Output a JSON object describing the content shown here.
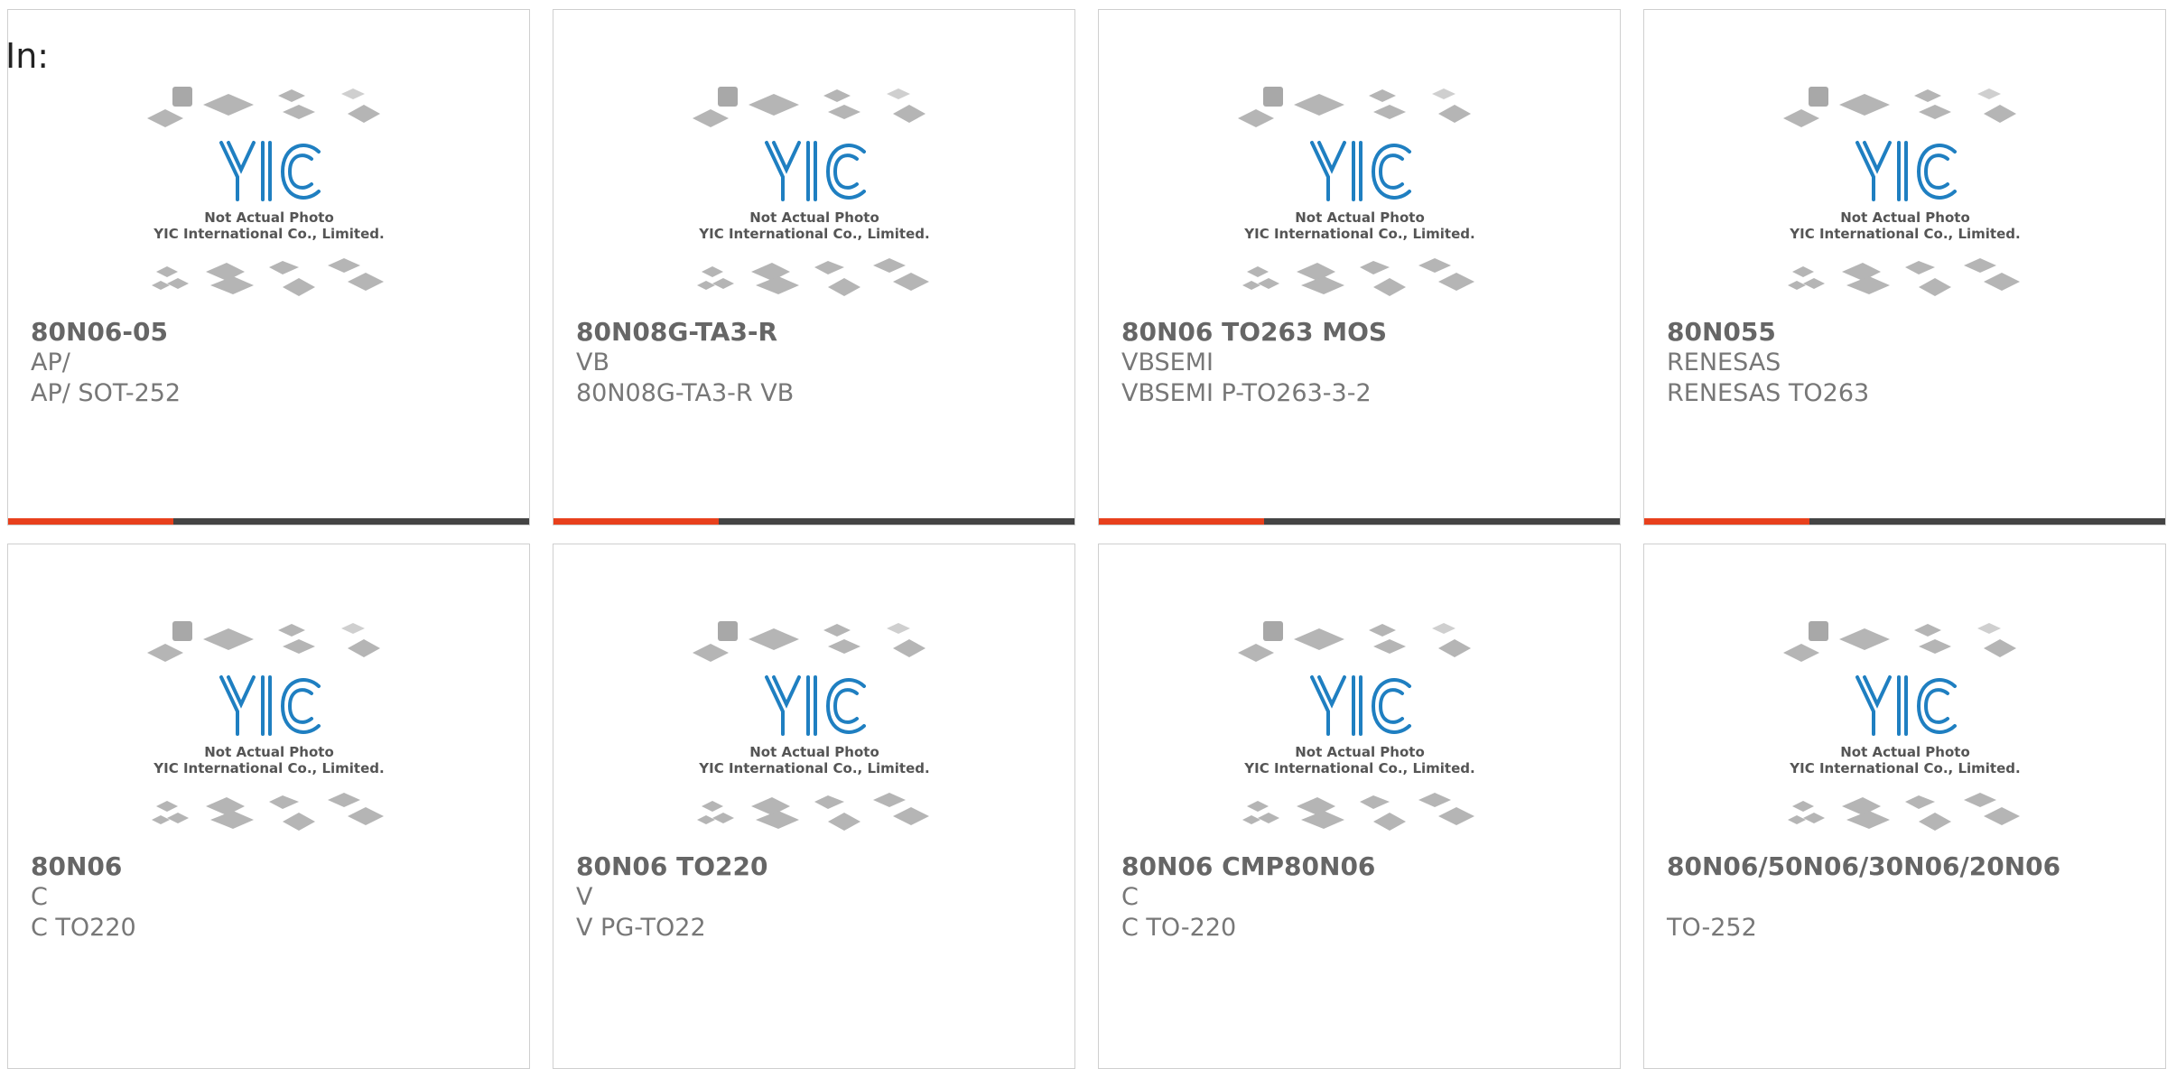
{
  "page": {
    "in_label": "In:"
  },
  "placeholder": {
    "logo_text": "YIC",
    "line1": "Not Actual Photo",
    "line2": "YIC International Co., Limited."
  },
  "colors": {
    "accent": "#e8401c",
    "bar_dark": "#444444",
    "logo_blue": "#1f7fc1"
  },
  "products": [
    {
      "part": "80N06-05",
      "manufacturer": "AP/",
      "manufacturer_package": "AP/ SOT-252"
    },
    {
      "part": "80N08G-TA3-R",
      "manufacturer": "VB",
      "manufacturer_package": "80N08G-TA3-R VB"
    },
    {
      "part": "80N06 TO263 MOS",
      "manufacturer": "VBSEMI",
      "manufacturer_package": "VBSEMI P-TO263-3-2"
    },
    {
      "part": "80N055",
      "manufacturer": "RENESAS",
      "manufacturer_package": "RENESAS TO263"
    },
    {
      "part": "80N06",
      "manufacturer": "C",
      "manufacturer_package": "C TO220"
    },
    {
      "part": "80N06 TO220",
      "manufacturer": "V",
      "manufacturer_package": "V PG-TO22"
    },
    {
      "part": "80N06 CMP80N06",
      "manufacturer": "C",
      "manufacturer_package": "C TO-220"
    },
    {
      "part": "80N06/50N06/30N06/20N06",
      "manufacturer": "",
      "manufacturer_package": "TO-252"
    }
  ]
}
